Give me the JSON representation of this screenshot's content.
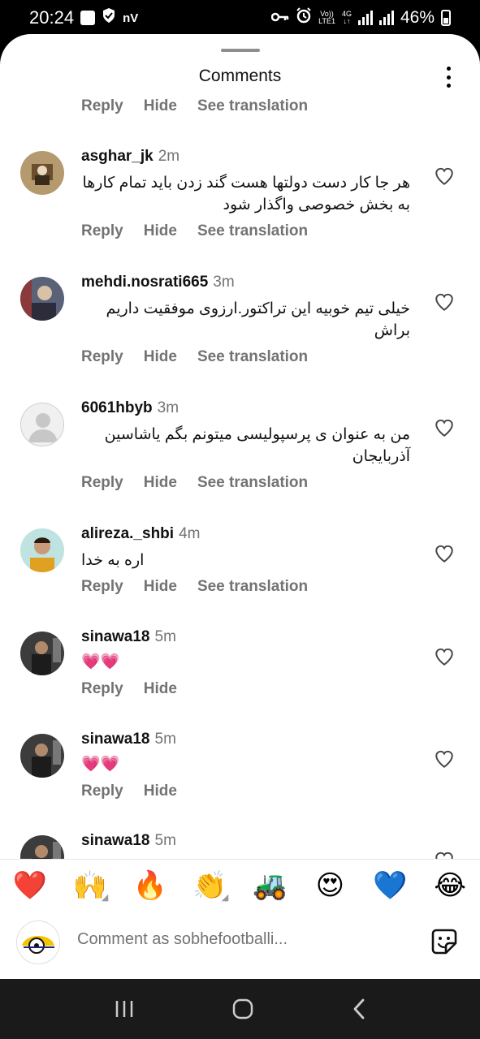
{
  "status_bar": {
    "time": "20:24",
    "notif_text": "nV",
    "volte_top": "Vo))",
    "volte_bottom": "LTE1",
    "network": "4G",
    "battery": "46%"
  },
  "header": {
    "title": "Comments"
  },
  "actions": {
    "reply": "Reply",
    "hide": "Hide",
    "see_translation": "See translation"
  },
  "comments": [
    {
      "username": "asghar_jk",
      "time": "2m",
      "text": "هر جا کار دست دولتها هست گند زدن باید تمام کارها به بخش خصوصی واگذار شود",
      "translatable": true
    },
    {
      "username": "mehdi.nosrati665",
      "time": "3m",
      "text": "خیلی تیم خوبیه این تراکتور.ارزوی موفقیت داریم براش",
      "translatable": true
    },
    {
      "username": "6061hbyb",
      "time": "3m",
      "text": "من به عنوان ی پرسپولیسی میتونم بگم یاشاسین آذربایجان",
      "translatable": true
    },
    {
      "username": "alireza._shbi",
      "time": "4m",
      "text": "اره به خدا",
      "translatable": true
    },
    {
      "username": "sinawa18",
      "time": "5m",
      "text": "💗💗",
      "translatable": false
    },
    {
      "username": "sinawa18",
      "time": "5m",
      "text": "💗💗",
      "translatable": false
    },
    {
      "username": "sinawa18",
      "time": "5m",
      "text": "",
      "translatable": false
    }
  ],
  "reactions": [
    "❤️",
    "🙌",
    "🔥",
    "👏",
    "🚜",
    "😍",
    "💙",
    "😂"
  ],
  "composer": {
    "placeholder": "Comment as sobhefootballi..."
  },
  "colors": {
    "secondary_text": "#737373",
    "background": "#ffffff",
    "nav_bar": "#1a1a1a"
  }
}
